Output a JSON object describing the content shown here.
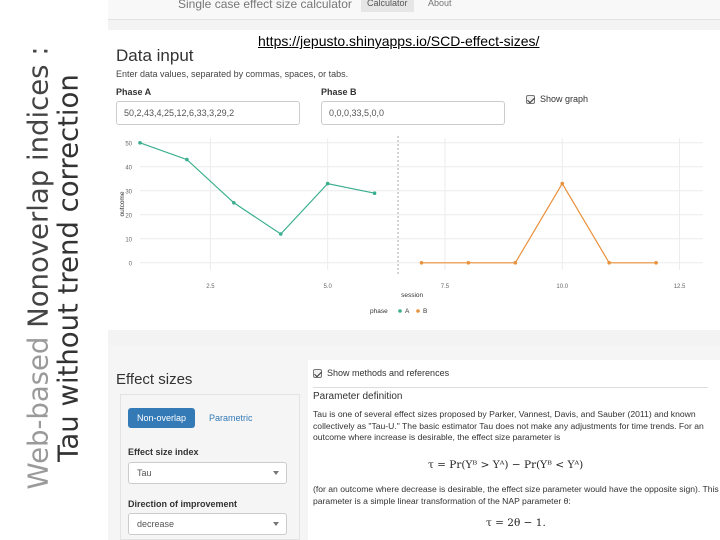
{
  "slide": {
    "title_prefix": "Web-based",
    "title_main": "Nonoverlap indices :",
    "title_line2": "Tau without trend correction",
    "url": "https://jepusto.shinyapps.io/SCD-effect-sizes/"
  },
  "navbar": {
    "brand": "Single case effect size calculator",
    "tabs": [
      {
        "label": "Calculator",
        "active": true
      },
      {
        "label": "About",
        "active": false
      }
    ]
  },
  "data_input": {
    "heading": "Data input",
    "help": "Enter data values, separated by commas, spaces, or tabs.",
    "phase_a_label": "Phase A",
    "phase_a_value": "50,2,43,4,25,12,6,33,3,29,2",
    "phase_b_label": "Phase B",
    "phase_b_value": "0,0,0,33,5,0,0",
    "show_graph_label": "Show graph",
    "show_graph_checked": true
  },
  "chart_data": {
    "type": "line",
    "xlabel": "session",
    "ylabel": "outcome",
    "xlim": [
      1,
      13
    ],
    "ylim": [
      -3,
      52
    ],
    "x_ticks": [
      "2.5",
      "5.0",
      "7.5",
      "10.0",
      "12.5"
    ],
    "y_ticks": [
      "0",
      "10",
      "20",
      "30",
      "40",
      "50"
    ],
    "phase_change_x": 6.5,
    "legend": {
      "title": "phase",
      "placement": "bottom"
    },
    "series": [
      {
        "name": "A",
        "color": "#3aaf8f",
        "x": [
          1,
          2,
          3,
          4,
          5,
          6
        ],
        "y": [
          50,
          43,
          25,
          12,
          33,
          29
        ]
      },
      {
        "name": "B",
        "color": "#e8913b",
        "x": [
          7,
          8,
          9,
          10,
          11,
          12
        ],
        "y": [
          0,
          0,
          0,
          33,
          0,
          0
        ]
      }
    ]
  },
  "effect_sizes": {
    "heading": "Effect sizes",
    "tabs": [
      "Non-overlap",
      "Parametric"
    ],
    "index_label": "Effect size index",
    "index_value": "Tau",
    "direction_label": "Direction of improvement",
    "direction_value": "decrease",
    "show_methods_label": "Show methods and references",
    "param_heading": "Parameter definition",
    "para1": "Tau is one of several effect sizes proposed by Parker, Vannest, Davis, and Sauber (2011) and known collectively as \"Tau-U.\" The basic estimator Tau does not make any adjustments for time trends. For an outcome where increase is desirable, the effect size parameter is",
    "formula1": "τ = Pr(Yᴮ > Yᴬ) − Pr(Yᴮ < Yᴬ)",
    "para2": "(for an outcome where decrease is desirable, the effect size parameter would have the opposite sign). This parameter is a simple linear transformation of the NAP parameter θ:",
    "formula2": "τ = 2θ − 1."
  }
}
